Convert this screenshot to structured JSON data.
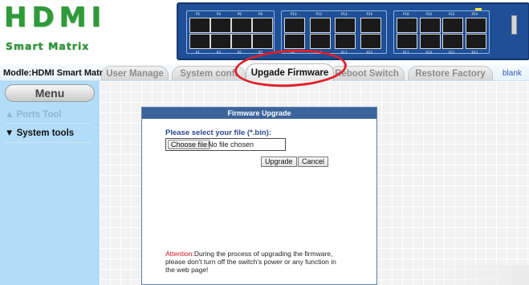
{
  "logo": {
    "title": "HDMI",
    "subtitle": "Smart Matrix"
  },
  "switch_panel": {
    "top_ports": [
      "P2",
      "P4",
      "P6",
      "P8",
      "P10",
      "P12",
      "P14",
      "P16",
      "P18",
      "P20",
      "P22",
      "P24"
    ],
    "bottom_ports": [
      "P1",
      "P3",
      "P5",
      "P7",
      "P9",
      "P11",
      "P13",
      "P15",
      "P17",
      "P19",
      "P21",
      "P23"
    ]
  },
  "model_label": "Modle:HDMI Smart Matrix",
  "tabs": [
    {
      "label": "User Manage"
    },
    {
      "label": "System confi"
    },
    {
      "label": "Upgade Firmware"
    },
    {
      "label": "Reboot Switch"
    },
    {
      "label": "Restore Factory"
    }
  ],
  "blank_link": "blank",
  "sidebar": {
    "menu_label": "Menu",
    "items": [
      {
        "label": "Ports Tool",
        "prefix": "▲"
      },
      {
        "label": "System tools",
        "prefix": "▼"
      }
    ]
  },
  "dialog": {
    "title": "Firmware Upgrade",
    "select_label": "Please select your file (*.bin):",
    "choose_button": "Choose file",
    "file_status": "No file chosen",
    "upgrade_button": "Upgrade",
    "cancel_button": "Cancel",
    "attention_lead": "Attention:",
    "attention_text": "During the process of upgrading the firmware, please don't turn off the switch's power or any function in the web page!"
  },
  "colors": {
    "logo_green": "#2f9a3a",
    "sidebar_blue": "#b2dcf8",
    "dialog_header": "#3b649c",
    "highlight_red": "#e0202a",
    "panel_blue": "#1f4f96"
  }
}
